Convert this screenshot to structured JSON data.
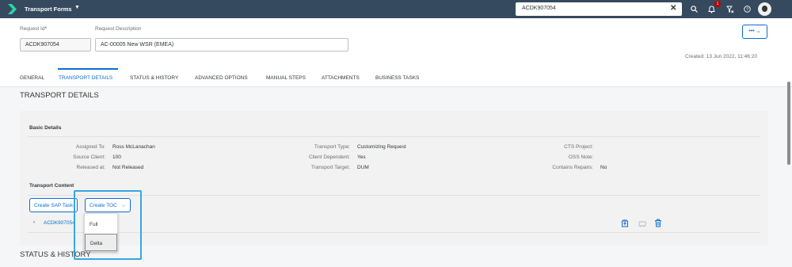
{
  "shell": {
    "app_title": "Transport Forms",
    "app_caret": "▼",
    "search_value": "ACDK907054",
    "search_clear": "✕",
    "notification_count": "1"
  },
  "header": {
    "request_id_label": "Request Id",
    "request_id_required": "*",
    "request_id_value": "ACDK907054",
    "request_desc_label": "Request Description",
    "request_desc_value": "AC-00005 New WSR (EMEA)",
    "more_button": "••• ⌄",
    "created": "Created: 13 Jun 2022, 11:46:20"
  },
  "tabs": [
    "GENERAL",
    "TRANSPORT DETAILS",
    "STATUS & HISTORY",
    "ADVANCED OPTIONS",
    "MANUAL STEPS",
    "ATTACHMENTS",
    "BUSINESS TASKS"
  ],
  "transport_details": {
    "section_title": "TRANSPORT DETAILS",
    "basic_details_title": "Basic Details",
    "col1": [
      {
        "label": "Assigned To:",
        "value": "Ross McLanachan"
      },
      {
        "label": "Source Client:",
        "value": "100"
      },
      {
        "label": "Released at:",
        "value": "Not Released"
      }
    ],
    "col2": [
      {
        "label": "Transport Type:",
        "value": "Customizing Request"
      },
      {
        "label": "Client Dependent:",
        "value": "Yes"
      },
      {
        "label": "Transport Target:",
        "value": "DUM"
      }
    ],
    "col3": [
      {
        "label": "CTS Project:",
        "value": ""
      },
      {
        "label": "OSS Note:",
        "value": ""
      },
      {
        "label": "Contains Repairs:",
        "value": "No"
      }
    ],
    "transport_content_title": "Transport Content",
    "create_sap_task": "Create SAP Task",
    "create_toc": "Create TOC",
    "create_toc_caret": "⌵",
    "row_expander": "›",
    "row_link": "ACDK907054",
    "toc_menu": [
      "Full",
      "Delta"
    ]
  },
  "status_history_title": "STATUS & HISTORY",
  "colors": {
    "shell_bg": "#354a5f",
    "accent": "#0a6ed1",
    "highlight": "#35a7e5"
  }
}
